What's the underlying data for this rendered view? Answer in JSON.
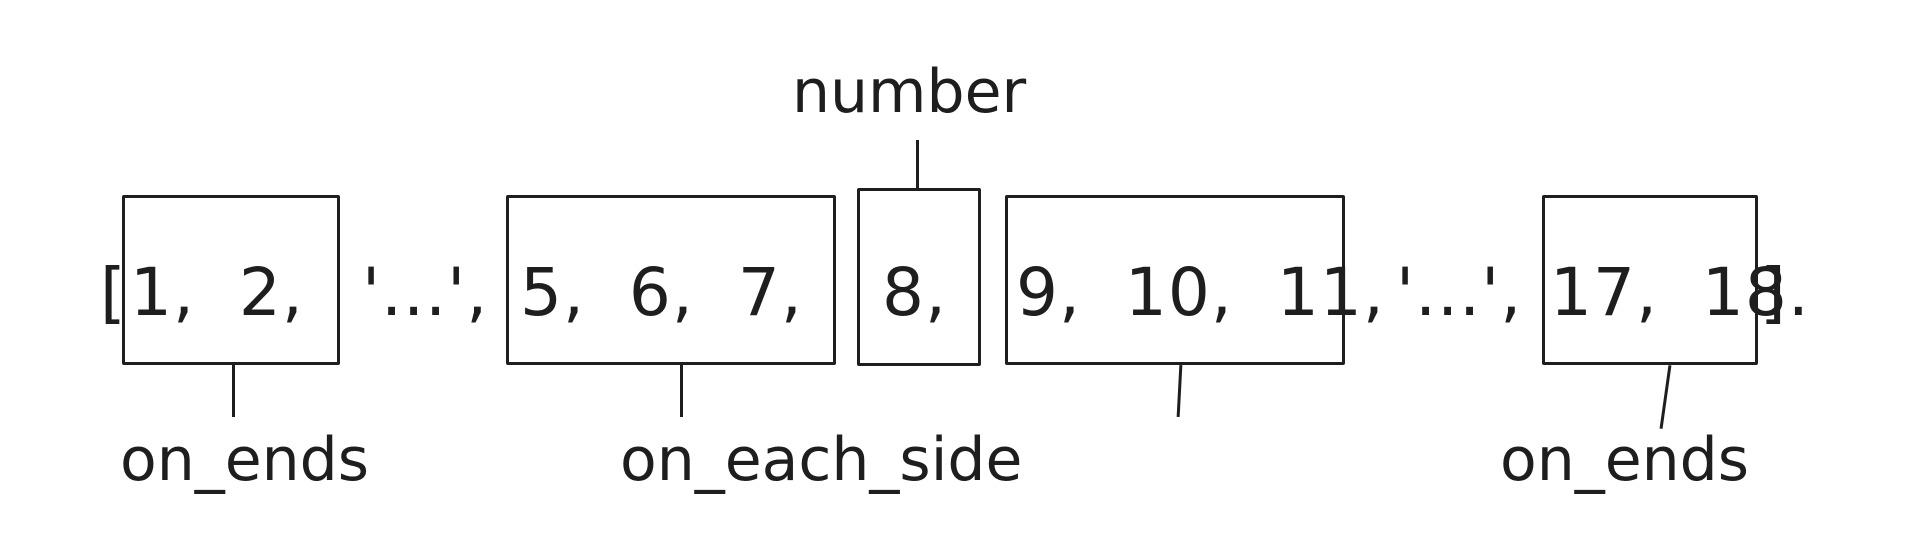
{
  "sequence": {
    "open_bracket": "[",
    "close_bracket": "]",
    "group_left_end": "1,  2,",
    "ellipsis_left": "'...',",
    "group_left_side": "5,  6,  7,",
    "number": "8,",
    "group_right_side": "9,  10,  11,",
    "ellipsis_right": "'...',",
    "group_right_end": "17,  18."
  },
  "labels": {
    "top_number": "number",
    "left_ends": "on_ends",
    "each_side": "on_each_side",
    "right_ends": "on_ends"
  },
  "colors": {
    "stroke": "#1e1e1e",
    "background": "#ffffff"
  }
}
